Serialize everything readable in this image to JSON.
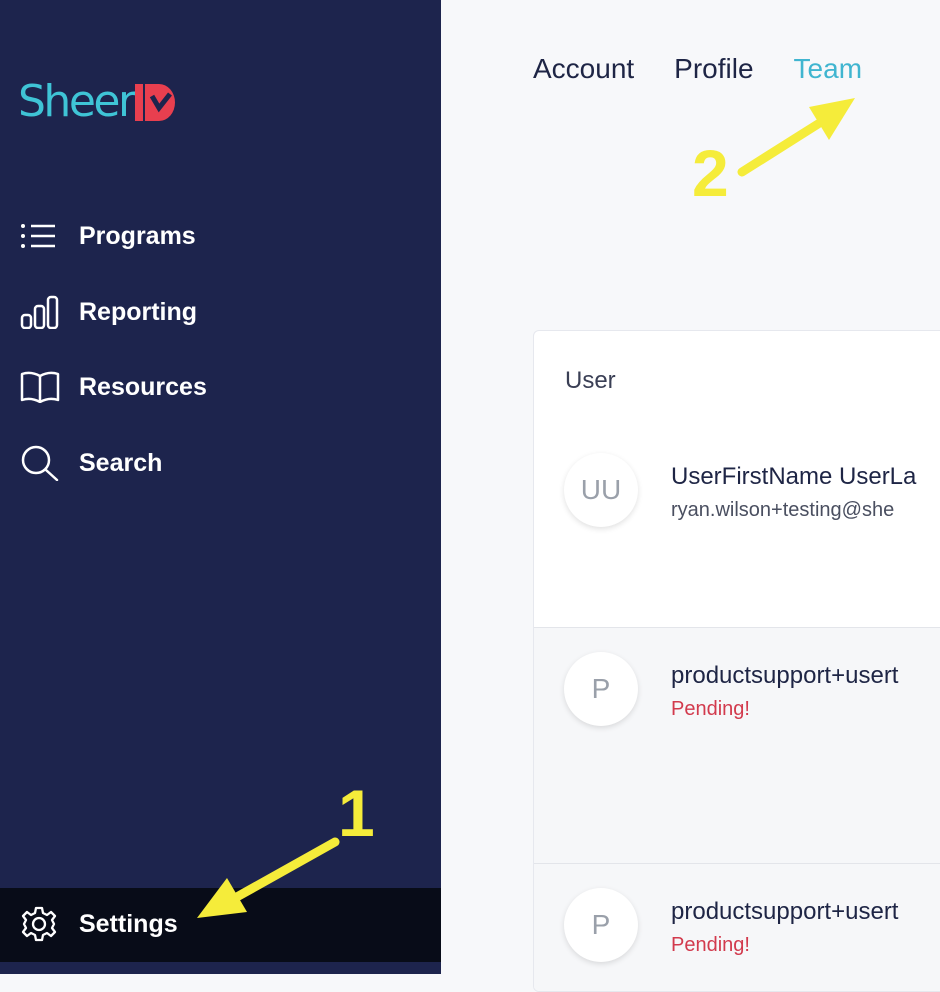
{
  "sidebar": {
    "logo": {
      "text": "Sheer"
    },
    "items": [
      {
        "label": "Programs",
        "icon": "list-icon"
      },
      {
        "label": "Reporting",
        "icon": "bar-chart-icon"
      },
      {
        "label": "Resources",
        "icon": "book-icon"
      },
      {
        "label": "Search",
        "icon": "search-icon"
      }
    ],
    "settings": {
      "label": "Settings",
      "icon": "gear-icon"
    }
  },
  "tabs": [
    {
      "label": "Account",
      "active": false
    },
    {
      "label": "Profile",
      "active": false
    },
    {
      "label": "Team",
      "active": true
    }
  ],
  "team_table": {
    "column_header": "User",
    "rows": [
      {
        "initials": "UU",
        "name": "UserFirstName UserLa",
        "subtext": "ryan.wilson+testing@she",
        "status": ""
      },
      {
        "initials": "P",
        "name": "productsupport+usert",
        "subtext": "Pending!",
        "status": "pending"
      },
      {
        "initials": "P",
        "name": "productsupport+usert",
        "subtext": "Pending!",
        "status": "pending"
      }
    ]
  },
  "annotations": [
    {
      "number": "1",
      "points_to": "settings"
    },
    {
      "number": "2",
      "points_to": "team-tab"
    }
  ],
  "colors": {
    "sidebar_bg": "#1d244d",
    "settings_bg": "#080c18",
    "accent": "#40b5d0",
    "logo_red": "#e83f4f",
    "pending": "#d23a4d",
    "annotation": "#f5ec3a"
  }
}
